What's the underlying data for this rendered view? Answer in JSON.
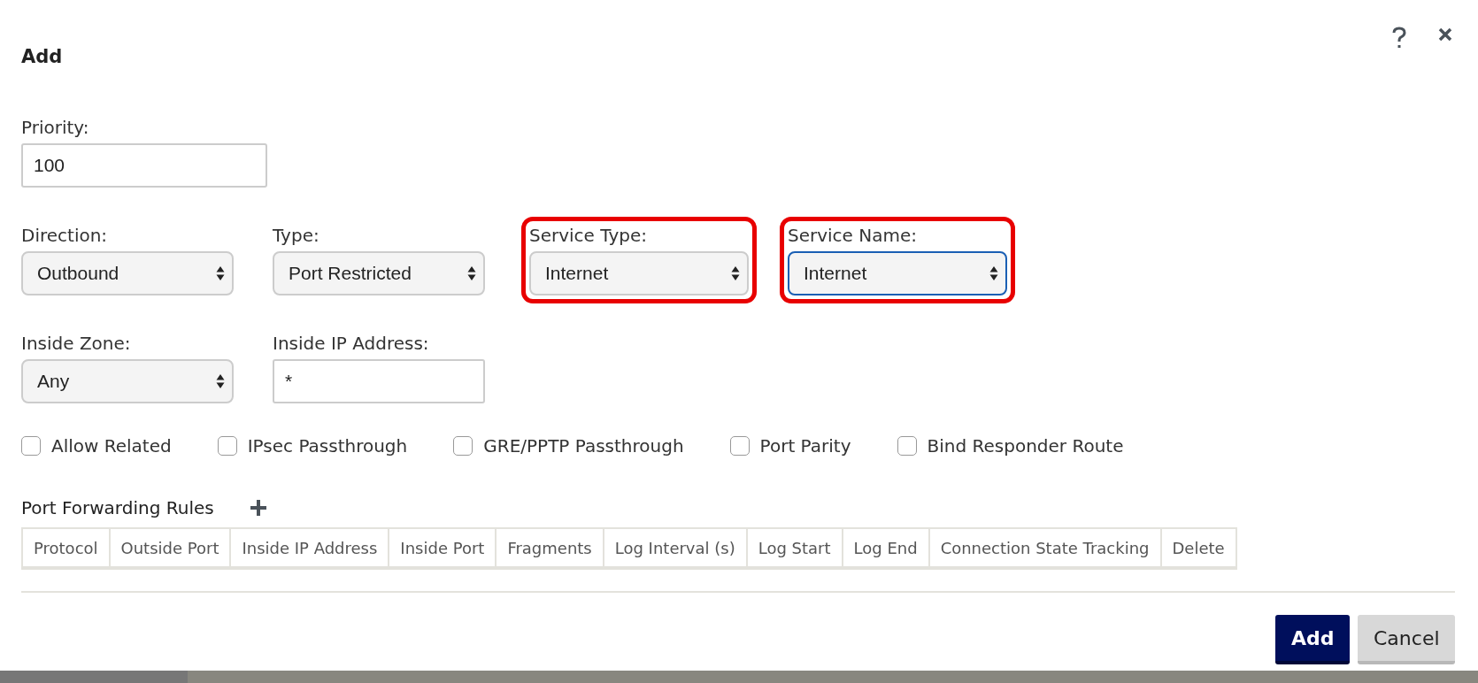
{
  "dialog": {
    "title": "Add"
  },
  "form_rows": [
    [
      {
        "label": "Priority:",
        "kind": "text",
        "value": "100",
        "highlighted": false,
        "focused": false
      }
    ],
    [
      {
        "label": "Direction:",
        "kind": "select",
        "value": "Outbound",
        "highlighted": false,
        "focused": false
      },
      {
        "label": "Type:",
        "kind": "select",
        "value": "Port Restricted",
        "highlighted": false,
        "focused": false
      },
      {
        "label": "Service Type:",
        "kind": "select",
        "value": "Internet",
        "highlighted": true,
        "focused": false
      },
      {
        "label": "Service Name:",
        "kind": "select",
        "value": "Internet",
        "highlighted": true,
        "focused": true
      }
    ],
    [
      {
        "label": "Inside Zone:",
        "kind": "select",
        "value": "Any",
        "highlighted": false,
        "focused": false
      },
      {
        "label": "Inside IP Address:",
        "kind": "text",
        "value": "*",
        "highlighted": false,
        "focused": false
      }
    ]
  ],
  "options": [
    {
      "label": "Allow Related",
      "checked": false
    },
    {
      "label": "IPsec Passthrough",
      "checked": false
    },
    {
      "label": "GRE/PPTP Passthrough",
      "checked": false
    },
    {
      "label": "Port Parity",
      "checked": false
    },
    {
      "label": "Bind Responder Route",
      "checked": false
    }
  ],
  "port_forwarding": {
    "title": "Port Forwarding Rules",
    "columns": [
      "Protocol",
      "Outside Port",
      "Inside IP Address",
      "Inside Port",
      "Fragments",
      "Log Interval (s)",
      "Log Start",
      "Log End",
      "Connection State Tracking",
      "Delete"
    ]
  },
  "buttons": [
    {
      "label": "Add",
      "kind": "primary"
    },
    {
      "label": "Cancel",
      "kind": "secondary"
    }
  ]
}
